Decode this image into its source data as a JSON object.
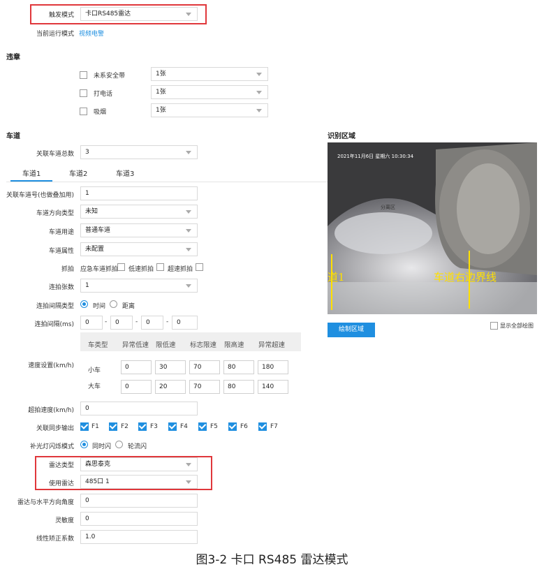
{
  "trigger": {
    "label": "触发模式",
    "value": "卡口RS485雷达",
    "mode_label": "当前运行模式",
    "mode_value": "视频电警"
  },
  "violation": {
    "title": "违章",
    "items": [
      {
        "label": "未系安全带",
        "value": "1张"
      },
      {
        "label": "打电话",
        "value": "1张"
      },
      {
        "label": "吸烟",
        "value": "1张"
      }
    ]
  },
  "lane": {
    "title": "车道",
    "total_label": "关联车道总数",
    "total_value": "3",
    "tabs": [
      "车道1",
      "车道2",
      "车道3"
    ],
    "fields": {
      "lane_no_label": "关联车道号(也做叠加用)",
      "lane_no_value": "1",
      "direction_label": "车道方向类型",
      "direction_value": "未知",
      "usage_label": "车道用途",
      "usage_value": "普通车道",
      "attr_label": "车道属性",
      "attr_value": "未配置",
      "capture_label": "抓拍",
      "capture_opts": [
        "应急车道抓拍",
        "低速抓拍",
        "超速抓拍"
      ],
      "burst_label": "连拍张数",
      "burst_value": "1",
      "interval_type_label": "连拍间隔类型",
      "interval_opts": [
        "时间",
        "距离"
      ],
      "interval_label": "连拍间隔(ms)",
      "interval_values": [
        "0",
        "0",
        "0",
        "0"
      ],
      "speed_label": "速度设置(km/h)",
      "speed_headers": [
        "车类型",
        "异常低速",
        "限低速",
        "标志限速",
        "限高速",
        "异常超速"
      ],
      "speed_rows": [
        {
          "type": "小车",
          "values": [
            "0",
            "30",
            "70",
            "80",
            "180"
          ]
        },
        {
          "type": "大车",
          "values": [
            "0",
            "20",
            "70",
            "80",
            "140"
          ]
        }
      ],
      "overspeed_label": "超拍速度(km/h)",
      "overspeed_value": "0",
      "sync_label": "关联同步输出",
      "sync_opts": [
        "F1",
        "F2",
        "F3",
        "F4",
        "F5",
        "F6",
        "F7"
      ],
      "flash_label": "补光灯闪烁模式",
      "flash_opts": [
        "同时闪",
        "轮流闪"
      ],
      "radar_type_label": "雷达类型",
      "radar_type_value": "森思泰克",
      "radar_use_label": "使用雷达",
      "radar_use_value": "485口 1",
      "angle_label": "雷达与水平方向角度",
      "angle_value": "0",
      "sens_label": "灵敏度",
      "sens_value": "0",
      "linear_label": "线性矫正系数",
      "linear_value": "1.0"
    }
  },
  "region": {
    "title": "识别区域",
    "osd": "2021年11月6日 星期六 10:30:34",
    "mark": "分离区",
    "left_line": "道1",
    "right_line": "车道右边界线",
    "draw_button": "绘制区域",
    "show_all": "显示全部绘图"
  },
  "caption": "图3-2 卡口 RS485 雷达模式",
  "colors": {
    "accent": "#1f8fe0",
    "red": "#e0373b",
    "overlay": "#ffe000"
  }
}
